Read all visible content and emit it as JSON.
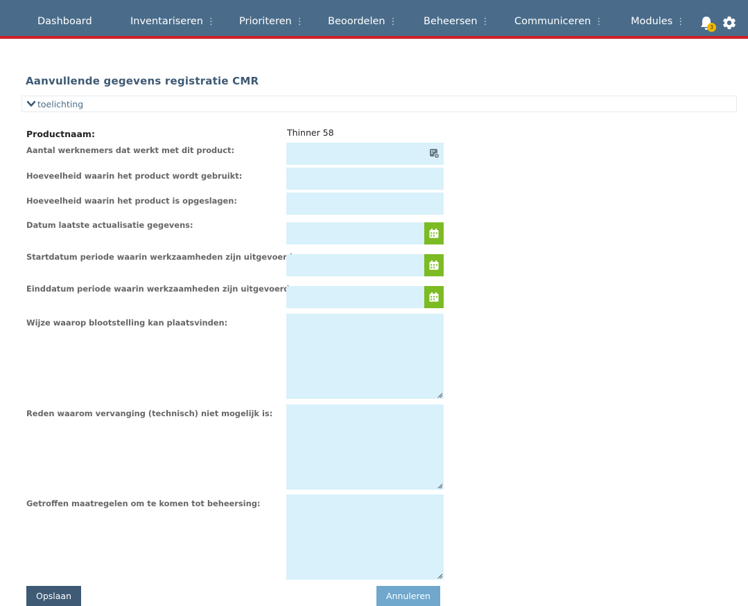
{
  "nav": {
    "items": [
      {
        "label": "Dashboard",
        "dropdown": false
      },
      {
        "label": "Inventariseren",
        "dropdown": true
      },
      {
        "label": "Prioriteren",
        "dropdown": true
      },
      {
        "label": "Beoordelen",
        "dropdown": true
      },
      {
        "label": "Beheersen",
        "dropdown": true
      },
      {
        "label": "Communiceren",
        "dropdown": true
      },
      {
        "label": "Modules",
        "dropdown": true
      }
    ],
    "notification_count": "3",
    "icons": [
      "bell-icon",
      "gear-icon"
    ]
  },
  "page": {
    "title": "Aanvullende gegevens registratie CMR",
    "toggle_label": "toelichting"
  },
  "form": {
    "product_name_label": "Productnaam:",
    "product_name_value": "Thinner 58",
    "fields": [
      {
        "label": "Aantal werknemers dat werkt met dit product:",
        "type": "number",
        "value": ""
      },
      {
        "label": "Hoeveelheid waarin het product wordt gebruikt:",
        "type": "text",
        "value": ""
      },
      {
        "label": "Hoeveelheid waarin het product is opgeslagen:",
        "type": "text",
        "value": ""
      },
      {
        "label": "Datum laatste actualisatie gegevens:",
        "type": "date",
        "value": ""
      },
      {
        "label": "Startdatum periode waarin werkzaamheden zijn uitgevoerd:",
        "type": "date",
        "value": ""
      },
      {
        "label": "Einddatum periode waarin werkzaamheden zijn uitgevoerd:",
        "type": "date",
        "value": ""
      },
      {
        "label": "Wijze waarop blootstelling kan plaatsvinden:",
        "type": "textarea",
        "value": ""
      },
      {
        "label": "Reden waarom vervanging (technisch) niet mogelijk is:",
        "type": "textarea",
        "value": ""
      },
      {
        "label": "Getroffen maatregelen om te komen tot beheersing:",
        "type": "textarea",
        "value": ""
      }
    ]
  },
  "buttons": {
    "save": "Opslaan",
    "cancel": "Annuleren"
  },
  "colors": {
    "nav_bg": "#4a6c8a",
    "nav_accent": "#cf2027",
    "field_bg": "#d8f1fb",
    "calendar_btn": "#7cbb23",
    "save_btn": "#3e5a74",
    "cancel_btn": "#6fa7cd",
    "badge": "#f2b705"
  }
}
